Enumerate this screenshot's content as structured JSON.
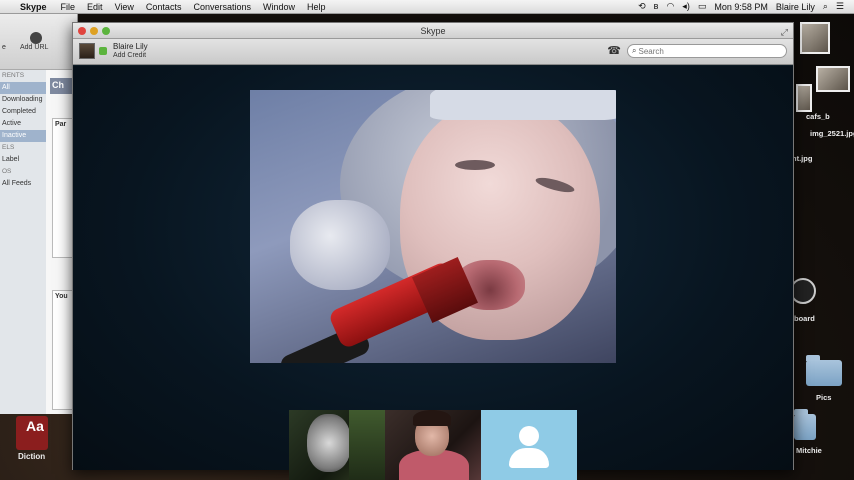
{
  "menubar": {
    "app": "Skype",
    "items": [
      "File",
      "Edit",
      "View",
      "Contacts",
      "Conversations",
      "Window",
      "Help"
    ],
    "clock": "Mon 9:58 PM",
    "user": "Blaire Lily"
  },
  "bg_app": {
    "toolbar_labels": [
      "e",
      "Add URL"
    ],
    "sidebar": [
      {
        "label": "RENTS",
        "type": "header"
      },
      {
        "label": "All",
        "type": "selected"
      },
      {
        "label": "Downloading",
        "type": "item"
      },
      {
        "label": "Completed",
        "type": "item"
      },
      {
        "label": "Active",
        "type": "item"
      },
      {
        "label": "Inactive",
        "type": "selected"
      },
      {
        "label": "ELS",
        "type": "header"
      },
      {
        "label": "Label",
        "type": "item"
      },
      {
        "label": "OS",
        "type": "header"
      },
      {
        "label": "All Feeds",
        "type": "item"
      }
    ],
    "chip": "Ch",
    "panels": [
      "Par",
      "You"
    ]
  },
  "dock": {
    "dictionary_glyph": "Aa",
    "dictionary_label": "Diction"
  },
  "desktop": {
    "labels": [
      "cafs_b",
      "img_2521.jpg",
      "nt.jpg",
      "board",
      "Pics",
      "Mitchie"
    ]
  },
  "skype": {
    "window_title": "Skype",
    "user_name": "Blaire Lily",
    "add_credit": "Add Credit",
    "search_placeholder": "Search"
  }
}
